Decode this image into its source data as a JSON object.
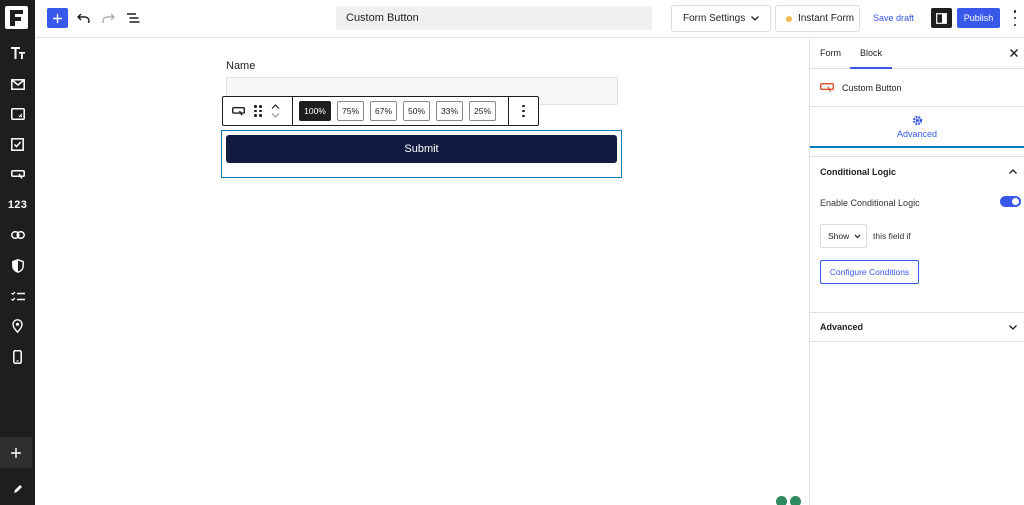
{
  "app": {
    "colors": {
      "accent": "#3858e9",
      "dark": "#1e1e1e",
      "submit_bg": "#111b40",
      "selection": "#007cba"
    }
  },
  "rail": {
    "items": [
      {
        "icon": "text-type-icon"
      },
      {
        "icon": "mail-icon"
      },
      {
        "icon": "textarea-icon"
      },
      {
        "icon": "checkbox-icon"
      },
      {
        "icon": "button-icon"
      },
      {
        "icon": "number-icon",
        "text": "123"
      },
      {
        "icon": "link-icon"
      },
      {
        "icon": "shield-icon"
      },
      {
        "icon": "checklist-icon"
      },
      {
        "icon": "location-pin-icon"
      },
      {
        "icon": "phone-icon"
      }
    ],
    "add_icon": "plus-icon",
    "edit_icon": "pen-icon"
  },
  "topbar": {
    "title": "Custom Button",
    "form_settings": "Form Settings",
    "instant_form": "Instant Form",
    "save_draft": "Save draft",
    "publish": "Publish"
  },
  "canvas": {
    "name_label": "Name",
    "submit_label": "Submit",
    "width_options": [
      "100%",
      "75%",
      "67%",
      "50%",
      "33%",
      "25%"
    ],
    "selected_width": "100%"
  },
  "panel": {
    "tabs": [
      "Form",
      "Block"
    ],
    "active_tab": "Block",
    "block_name": "Custom Button",
    "advanced_tab": "Advanced",
    "conditional_logic": {
      "title": "Conditional Logic",
      "enable_label": "Enable Conditional Logic",
      "enabled": true,
      "show_value": "Show",
      "field_if": "this field if",
      "configure": "Configure Conditions"
    },
    "advanced_section": "Advanced"
  }
}
